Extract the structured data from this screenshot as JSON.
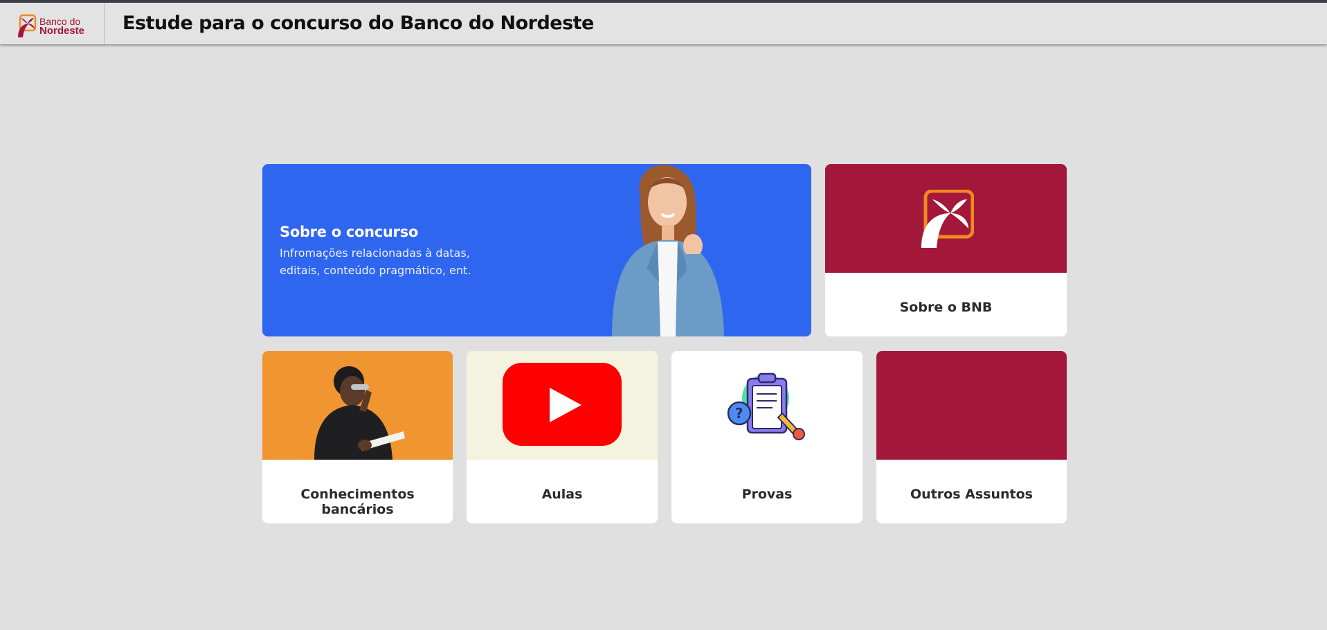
{
  "header": {
    "logo_line1": "Banco do",
    "logo_line2": "Nordeste",
    "title": "Estude para o concurso do Banco do Nordeste"
  },
  "hero": {
    "title": "Sobre o concurso",
    "description": "Infromações relacionadas à datas, editais, conteúdo pragmático, ent."
  },
  "cards": {
    "bnb": "Sobre o BNB",
    "bancarios": "Conhecimentos bancários",
    "aulas": "Aulas",
    "provas": "Provas",
    "outros": "Outros Assuntos"
  },
  "colors": {
    "brand": "#a3183a",
    "hero_bg": "#2f66f0",
    "orange": "#f19530",
    "youtube": "#ff0000"
  },
  "icons": {
    "logo": "banco-do-nordeste-logo-icon",
    "youtube": "youtube-play-icon",
    "provas": "clipboard-quiz-icon"
  }
}
